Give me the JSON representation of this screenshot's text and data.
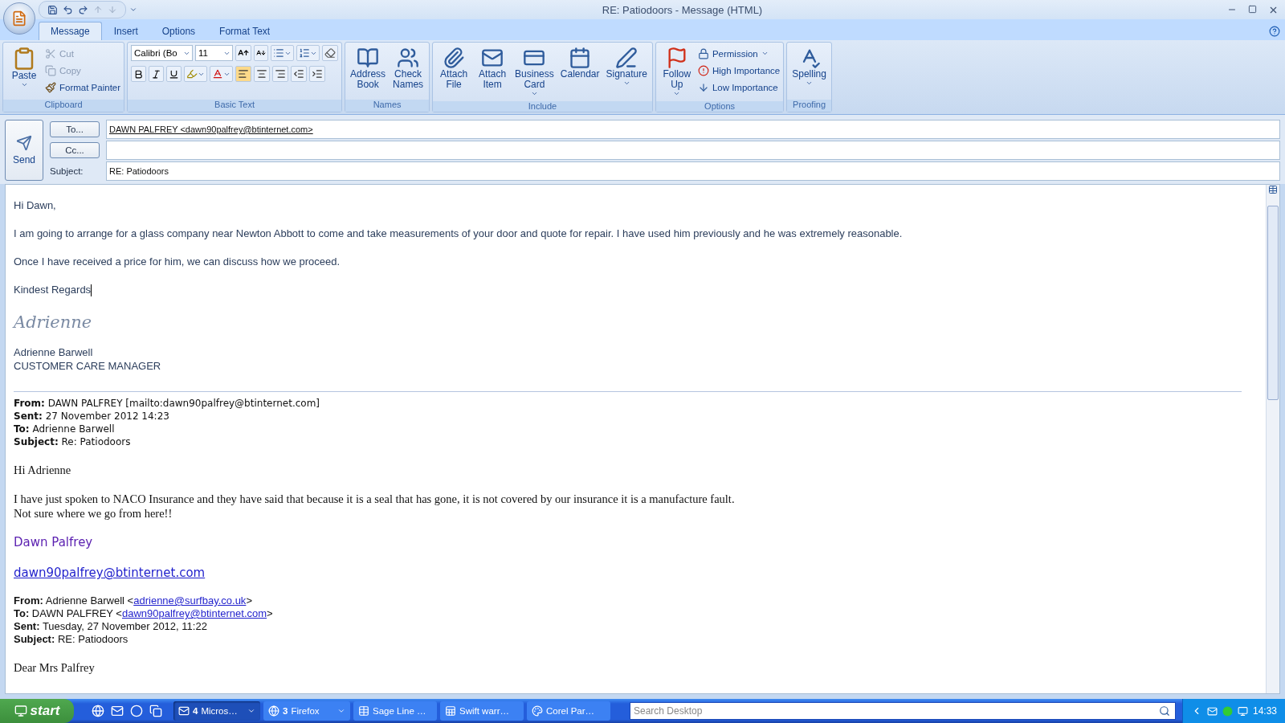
{
  "window": {
    "title": "RE: Patiodoors - Message (HTML)"
  },
  "tabs": [
    {
      "label": "Message",
      "selected": true
    },
    {
      "label": "Insert",
      "selected": false
    },
    {
      "label": "Options",
      "selected": false
    },
    {
      "label": "Format Text",
      "selected": false
    }
  ],
  "ribbon": {
    "groups": [
      {
        "kind": "clipboard",
        "label": "Clipboard",
        "paste": "Paste",
        "items": [
          {
            "label": "Cut",
            "disabled": true
          },
          {
            "label": "Copy",
            "disabled": true
          },
          {
            "label": "Format Painter",
            "disabled": false
          }
        ]
      },
      {
        "kind": "basic_text",
        "label": "Basic Text",
        "font": "Calibri (Bo",
        "size": "11",
        "align": [
          {
            "selected": true
          },
          {
            "selected": false
          },
          {
            "selected": false
          }
        ]
      },
      {
        "kind": "names",
        "label": "Names",
        "items": [
          {
            "label": "Address Book",
            "dropdown": false
          },
          {
            "label": "Check Names",
            "dropdown": false
          }
        ]
      },
      {
        "kind": "include",
        "label": "Include",
        "items": [
          {
            "label": "Attach File",
            "dropdown": false
          },
          {
            "label": "Attach Item",
            "dropdown": false
          },
          {
            "label": "Business Card",
            "dropdown": true
          },
          {
            "label": "Calendar",
            "dropdown": false
          },
          {
            "label": "Signature",
            "dropdown": true
          }
        ]
      },
      {
        "kind": "options",
        "label": "Options",
        "follow": "Follow Up",
        "items": [
          {
            "label": "Permission",
            "dropdown": true
          },
          {
            "label": "High Importance",
            "dropdown": false
          },
          {
            "label": "Low Importance",
            "dropdown": false
          }
        ]
      },
      {
        "kind": "proofing",
        "label": "Proofing",
        "items": [
          {
            "label": "Spelling",
            "dropdown": true
          }
        ]
      }
    ]
  },
  "header": {
    "send": "Send",
    "to_button": "To...",
    "to_value": "DAWN PALFREY <dawn90palfrey@btinternet.com>",
    "cc_button": "Cc...",
    "subject_label": "Subject:",
    "subject_value": "RE: Patiodoors"
  },
  "body": {
    "blocks": [
      {
        "kind": "para",
        "text": "Hi Dawn,",
        "cursor": false
      },
      {
        "kind": "para",
        "text": "I am going to arrange for a glass company near Newton Abbott to come and take measurements of your door and quote for repair.  I have used him previously and he was extremely reasonable.",
        "cursor": false
      },
      {
        "kind": "para",
        "text": "Once I have received a price for him, we can discuss how we proceed.",
        "cursor": false
      },
      {
        "kind": "para",
        "text": "Kindest Regards",
        "cursor": true
      },
      {
        "kind": "handwriting",
        "text": "Adrienne"
      },
      {
        "kind": "lines",
        "lines": [
          "Adrienne Barwell",
          "CUSTOMER CARE MANAGER"
        ]
      },
      {
        "kind": "rule"
      },
      {
        "kind": "header",
        "lines": [
          {
            "text": "**From:** DAWN PALFREY [mailto:dawn90palfrey@btinternet.com]"
          },
          {
            "text": "**Sent:** 27 November 2012 14:23"
          },
          {
            "text": "**To:** Adrienne Barwell"
          },
          {
            "text": "**Subject:** Re: Patiodoors"
          }
        ]
      },
      {
        "kind": "serif",
        "lines": [
          "Hi Adrienne"
        ]
      },
      {
        "kind": "serif",
        "lines": [
          "I have just spoken to NACO Insurance and they have said that because it is a seal that has gone, it is not covered by our insurance it is a manufacture fault.",
          "Not sure where we go from here!!"
        ]
      },
      {
        "kind": "script_name",
        "text": "Dawn Palfrey"
      },
      {
        "kind": "big_link",
        "text": "dawn90palfrey@btinternet.com"
      },
      {
        "kind": "header_links",
        "lines": [
          {
            "text": "**From:** Adrienne Barwell <",
            "link": "adrienne@surfbay.co.uk",
            "after": ">"
          },
          {
            "text": "**To:** DAWN PALFREY <",
            "link": "dawn90palfrey@btinternet.com",
            "after": ">"
          },
          {
            "text": "**Sent:** Tuesday, 27 November 2012, 11:22"
          },
          {
            "text": "**Subject:** RE: Patiodoors"
          }
        ]
      },
      {
        "kind": "serif",
        "lines": [
          "Dear Mrs Palfrey"
        ]
      }
    ]
  },
  "taskbar": {
    "start": "start",
    "tasks": [
      {
        "count": "4",
        "label": "Micros…",
        "grouped": true,
        "selected": true
      },
      {
        "count": "3",
        "label": "Firefox",
        "grouped": true,
        "selected": false
      },
      {
        "label": "Sage Line …",
        "grouped": false,
        "selected": false
      },
      {
        "label": "Swift warr…",
        "grouped": false,
        "selected": false
      },
      {
        "label": "Corel Par…",
        "grouped": false,
        "selected": false
      }
    ],
    "search": {
      "placeholder": "Search Desktop"
    },
    "clock": "14:33"
  }
}
